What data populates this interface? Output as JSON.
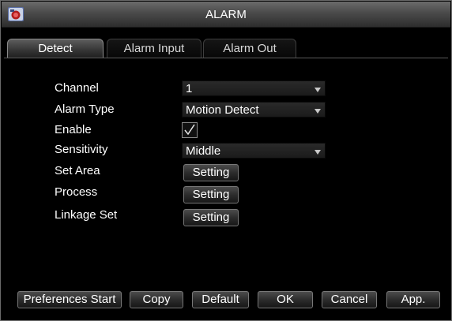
{
  "window": {
    "title": "ALARM",
    "app_icon": "camera-app-icon"
  },
  "tabs": [
    {
      "label": "Detect",
      "active": true
    },
    {
      "label": "Alarm Input",
      "active": false
    },
    {
      "label": "Alarm Out",
      "active": false
    }
  ],
  "form": {
    "channel": {
      "label": "Channel",
      "value": "1"
    },
    "alarm_type": {
      "label": "Alarm Type",
      "value": "Motion Detect"
    },
    "enable": {
      "label": "Enable",
      "checked": true
    },
    "sensitivity": {
      "label": "Sensitivity",
      "value": "Middle"
    },
    "set_area": {
      "label": "Set Area",
      "button": "Setting"
    },
    "process": {
      "label": "Process",
      "button": "Setting"
    },
    "linkage_set": {
      "label": "Linkage Set",
      "button": "Setting"
    }
  },
  "footer": {
    "preferences_start": "Preferences Start",
    "copy": "Copy",
    "default": "Default",
    "ok": "OK",
    "cancel": "Cancel",
    "apply": "App."
  },
  "colors": {
    "background": "#000000",
    "text": "#ffffff",
    "border": "#6a6a6a"
  }
}
